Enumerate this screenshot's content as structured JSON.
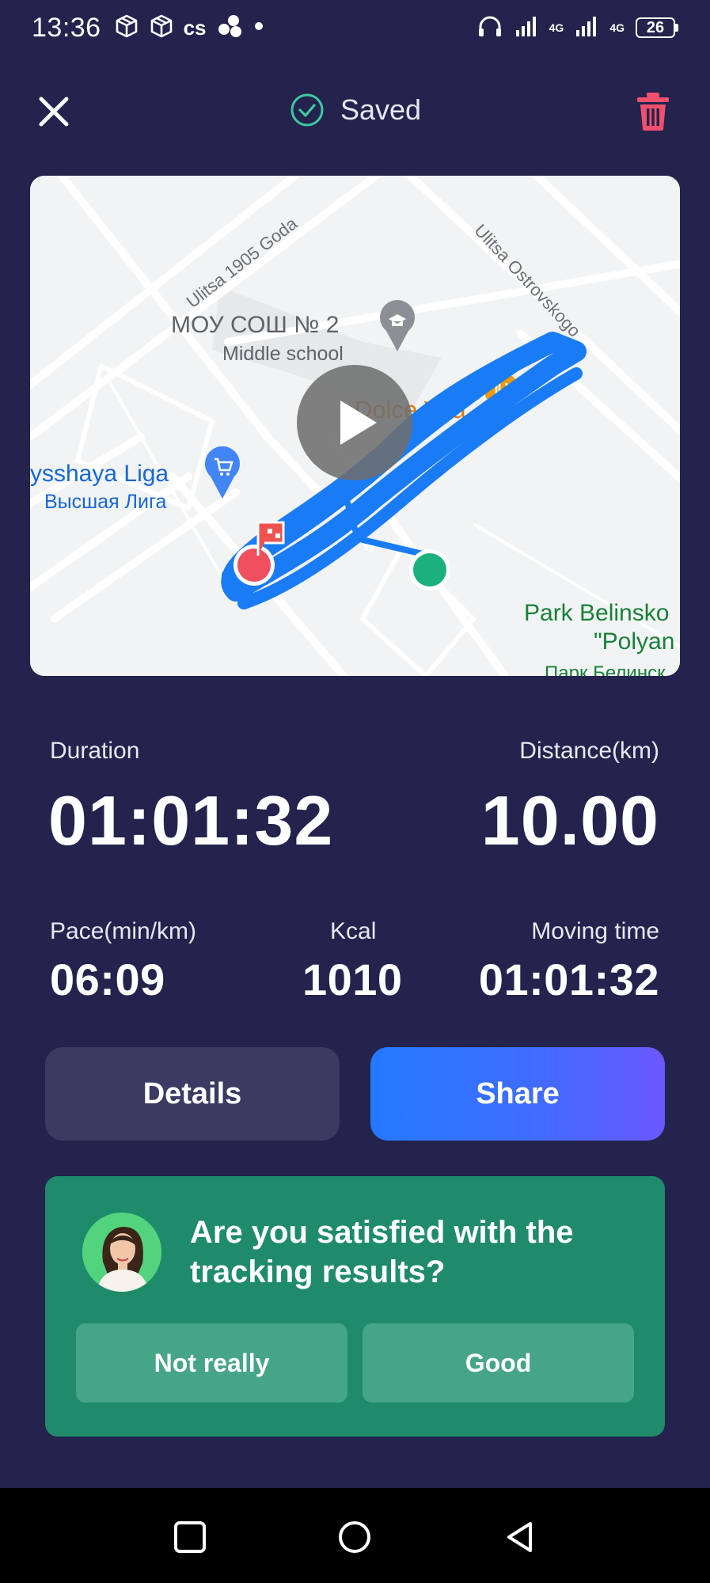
{
  "status_bar": {
    "time": "13:36",
    "left_icons": [
      "package-icon",
      "package-icon",
      "cs-icon",
      "app-cluster-icon",
      "dot-icon"
    ],
    "cs_label": "cs",
    "net1": "4G",
    "net2": "4G",
    "battery": "26"
  },
  "header": {
    "saved_label": "Saved",
    "close_icon": "close-icon",
    "saved_icon": "check-circle-icon",
    "trash_icon": "trash-icon"
  },
  "map": {
    "street_1": "Ulitsa 1905 Goda",
    "street_2": "Ulitsa Ostrovskogo",
    "school_name": "МОУ СОШ № 2",
    "school_type": "Middle school",
    "cafe": "Dolce Vita",
    "store_latin": "ysshaya Liga",
    "store_cyr": "Высшая Лига",
    "park_1": "Park Belinsko",
    "park_2": "\"Polyan",
    "park_3": "Парк Белинск",
    "play_icon": "play-icon",
    "route_color": "#1a7cf5"
  },
  "stats": {
    "duration_label": "Duration",
    "duration_value": "01:01:32",
    "distance_label": "Distance(km)",
    "distance_value": "10.00",
    "pace_label": "Pace(min/km)",
    "pace_value": "06:09",
    "kcal_label": "Kcal",
    "kcal_value": "1010",
    "moving_label": "Moving time",
    "moving_value": "01:01:32"
  },
  "actions": {
    "details_label": "Details",
    "share_label": "Share"
  },
  "feedback": {
    "question": "Are you satisfied with the tracking results?",
    "not_really_label": "Not really",
    "good_label": "Good"
  },
  "colors": {
    "background": "#23234d",
    "accent_green": "#1f8b6b",
    "trash_red": "#f0506e",
    "saved_check": "#3fc8a0"
  }
}
